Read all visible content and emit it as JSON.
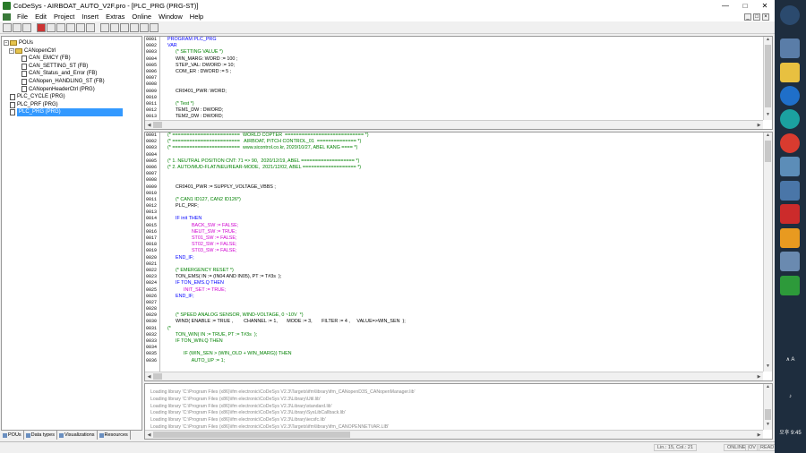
{
  "window": {
    "title": "CoDeSys - AIRBOAT_AUTO_V2F.pro - [PLC_PRG (PRG-ST)]"
  },
  "menu": [
    "File",
    "Edit",
    "Project",
    "Insert",
    "Extras",
    "Online",
    "Window",
    "Help"
  ],
  "tree": {
    "root": "POUs",
    "folder": "CANopenCtrl",
    "folder_items": [
      "CAN_EMCY (FB)",
      "CAN_SETTING_ST (FB)",
      "CAN_Status_and_Error (FB)",
      "CANopen_HANDLING_ST (FB)",
      "CANopenHeaderCtrl (PRG)"
    ],
    "items": [
      "PLC_CYCLE (PRG)",
      "PLC_PRF (PRG)",
      "PLC_PRG (PRG)"
    ],
    "selected": "PLC_PRG (PRG)"
  },
  "left_tabs": [
    "POUs",
    "Data types",
    "Visualizations",
    "Resources"
  ],
  "decl_lines": [
    {
      "n": "0001",
      "t": "PROGRAM PLC_PRG",
      "c": "kw"
    },
    {
      "n": "0002",
      "t": "VAR",
      "c": "kw"
    },
    {
      "n": "0003",
      "t": "      (* SETTING VALUE *)",
      "c": "cm"
    },
    {
      "n": "0004",
      "t": "      WIN_MARG: WORD := 100 ;",
      "c": "bk"
    },
    {
      "n": "0005",
      "t": "      STEP_VAL: DWORD := 10;",
      "c": "bk"
    },
    {
      "n": "0006",
      "t": "      COM_ER : DWORD := 5 ;",
      "c": "bk"
    },
    {
      "n": "0007",
      "t": "",
      "c": "bk"
    },
    {
      "n": "0008",
      "t": "",
      "c": "bk"
    },
    {
      "n": "0009",
      "t": "      CR0401_PWR: WORD;",
      "c": "bk"
    },
    {
      "n": "0010",
      "t": "",
      "c": "bk"
    },
    {
      "n": "0011",
      "t": "      (* Test *)",
      "c": "cm"
    },
    {
      "n": "0012",
      "t": "      TEM1_DW : DWORD;",
      "c": "bk"
    },
    {
      "n": "0013",
      "t": "      TEM2_DW : DWORD;",
      "c": "bk"
    }
  ],
  "body_lines": [
    {
      "n": "0001",
      "t": "(* ========================  WORLD COPTER  ============================ *)",
      "c": "cm"
    },
    {
      "n": "0002",
      "t": "(* ========================   AIRBOAT, PITCH CONTROL_01  ============== *)",
      "c": "cm"
    },
    {
      "n": "0003",
      "t": "(* ========================  www.sicontrol.co.kr, 2020/10/27, ABEL KANG ==== *)",
      "c": "cm"
    },
    {
      "n": "0004",
      "t": "",
      "c": "bk"
    },
    {
      "n": "0005",
      "t": "(* 1. NEUTRAL POSITION CNT: 71 => 90,  2020/12/19, ABEL =================== *)",
      "c": "cm"
    },
    {
      "n": "0006",
      "t": "(* 2. AUTO/MUD-FLAT/NEU/REAR-MODE,  2021/12/02, ABEL =================== *)",
      "c": "cm"
    },
    {
      "n": "0007",
      "t": "",
      "c": "bk"
    },
    {
      "n": "0008",
      "t": "",
      "c": "bk"
    },
    {
      "n": "0009",
      "t": "      CR0401_PWR := SUPPLY_VOLTAGE_VBBS ;",
      "c": "bk"
    },
    {
      "n": "0010",
      "t": "",
      "c": "bk"
    },
    {
      "n": "0011",
      "t": "      (* CAN1 ID127, CAN2 ID126*)",
      "c": "cm"
    },
    {
      "n": "0012",
      "t": "      PLC_PRF;",
      "c": "bk"
    },
    {
      "n": "0013",
      "t": "",
      "c": "bk"
    },
    {
      "n": "0014",
      "t": "      IF init THEN",
      "c": "kw"
    },
    {
      "n": "0015",
      "t": "                  BACK_SW := FALSE;",
      "c": "mg"
    },
    {
      "n": "0016",
      "t": "                  NEUT_SW := TRUE;",
      "c": "mg"
    },
    {
      "n": "0017",
      "t": "                  ST01_SW := FALSE;",
      "c": "mg"
    },
    {
      "n": "0018",
      "t": "                  ST02_SW := FALSE;",
      "c": "mg"
    },
    {
      "n": "0019",
      "t": "                  ST03_SW := FALSE;",
      "c": "mg"
    },
    {
      "n": "0020",
      "t": "      END_IF;",
      "c": "kw"
    },
    {
      "n": "0021",
      "t": "",
      "c": "bk"
    },
    {
      "n": "0022",
      "t": "      (* EMERGENCY RESET *)",
      "c": "cm"
    },
    {
      "n": "0023",
      "t": "      TON_EMS( IN := (IN04 AND IN05), PT := T#3s  );",
      "c": "bk"
    },
    {
      "n": "0024",
      "t": "      IF TON_EMS.Q THEN",
      "c": "kw"
    },
    {
      "n": "0025",
      "t": "            INIT_SET := TRUE;",
      "c": "mg"
    },
    {
      "n": "0026",
      "t": "      END_IF;",
      "c": "kw"
    },
    {
      "n": "0027",
      "t": "",
      "c": "bk"
    },
    {
      "n": "0028",
      "t": "",
      "c": "bk"
    },
    {
      "n": "0029",
      "t": "      (* SPEED ANALOG SENSOR, WIND-VOLTAGE, 0 ~10V  *)",
      "c": "cm"
    },
    {
      "n": "0030",
      "t": "      WIND( ENABLE := TRUE ,        CHANNEL := 1,       MODE := 3,       FILTER := 4 ,     VALUE=>WIN_SEN  );",
      "c": "bk"
    },
    {
      "n": "0031",
      "t": "(*",
      "c": "cm"
    },
    {
      "n": "0032",
      "t": "      TON_WIN( IN := TRUE, PT := T#3s  );",
      "c": "cm"
    },
    {
      "n": "0033",
      "t": "      IF TON_WIN.Q THEN",
      "c": "cm"
    },
    {
      "n": "0034",
      "t": "",
      "c": "bk"
    },
    {
      "n": "0035",
      "t": "            IF (WIN_SEN > (WIN_OLD + WIN_MARG)) THEN",
      "c": "cm"
    },
    {
      "n": "0036",
      "t": "                  AUTO_UP := 1;",
      "c": "cm"
    }
  ],
  "messages": [
    "Loading library 'C:\\Program Files (x86)\\ifm electronic\\CoDeSys V2.3\\Targets\\ifm\\library\\ifm_CANopenD3S_CANopenManager.lib'",
    "Loading library 'C:\\Program Files (x86)\\ifm electronic\\CoDeSys V2.3\\Library\\Util.lib'",
    "Loading library 'C:\\Program Files (x86)\\ifm electronic\\CoDeSys V2.3\\Library\\standard.lib'",
    "Loading library 'C:\\Program Files (x86)\\ifm electronic\\CoDeSys V2.3\\Library\\SysLibCallback.lib'",
    "Loading library 'C:\\Program Files (x86)\\ifm electronic\\CoDeSys V2.3\\Library\\iecsfc.lib'",
    "Loading library 'C:\\Program Files (x86)\\ifm electronic\\CoDeSys V2.3\\Targets\\ifm\\library\\ifm_CANOPENNETVAR.LIB'"
  ],
  "status": {
    "position": "Lin.: 15, Col.: 21",
    "online": "ONLINE",
    "ov": "OV",
    "read": "READ"
  },
  "tray": {
    "time": "오후 9:45",
    "ime": "A"
  }
}
